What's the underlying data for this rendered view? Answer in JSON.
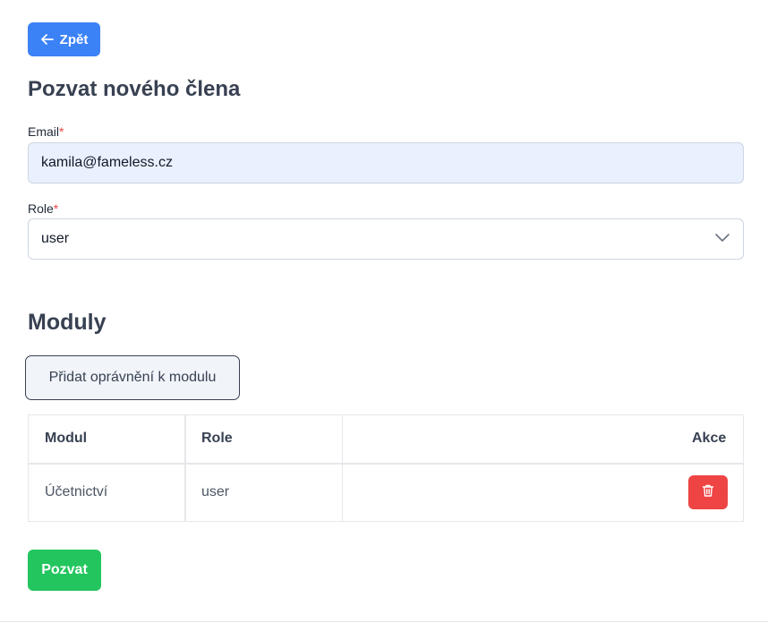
{
  "back_button": {
    "label": "Zpět",
    "icon": "arrow-left-icon"
  },
  "page_title": "Pozvat nového člena",
  "form": {
    "email": {
      "label": "Email",
      "required_mark": "*",
      "value": "kamila@fameless.cz"
    },
    "role": {
      "label": "Role",
      "required_mark": "*",
      "value": "user",
      "icon": "chevron-down-icon"
    }
  },
  "modules_section": {
    "title": "Moduly",
    "add_permission_label": "Přidat oprávnění k modulu",
    "table": {
      "headers": {
        "module": "Modul",
        "role": "Role",
        "actions": "Akce"
      },
      "rows": [
        {
          "module": "Účetnictví",
          "role": "user",
          "action_icon": "trash-icon"
        }
      ]
    }
  },
  "invite_button": {
    "label": "Pozvat"
  },
  "colors": {
    "primary": "#3b82f6",
    "success": "#22c55e",
    "danger": "#ef4444",
    "required": "#ef4444",
    "input_filled_bg": "#eaf1fe"
  }
}
